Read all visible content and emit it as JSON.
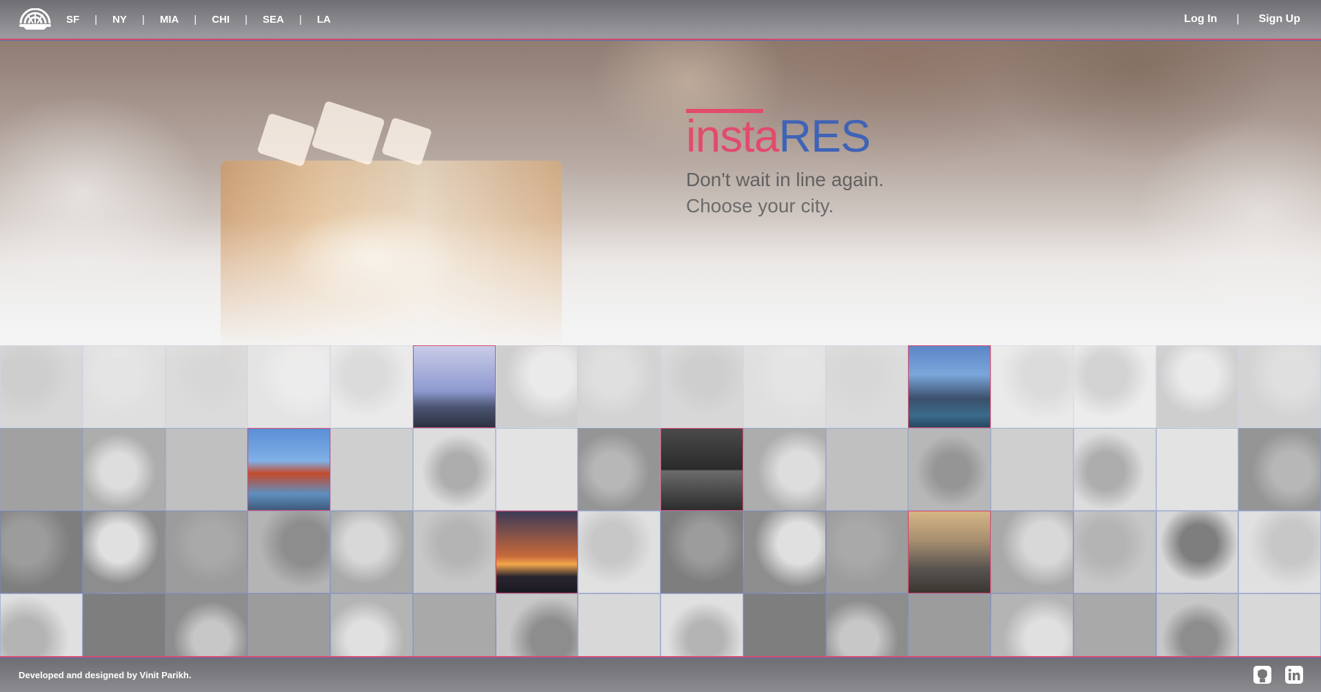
{
  "nav": {
    "cities": [
      "SF",
      "NY",
      "MIA",
      "CHI",
      "SEA",
      "LA"
    ],
    "separator": "|",
    "login": "Log In",
    "signup": "Sign Up"
  },
  "hero": {
    "brand_insta": "insta",
    "brand_res": "RES",
    "tagline_line1": "Don't wait in line again.",
    "tagline_line2": "Choose your city."
  },
  "footer": {
    "credit": "Developed and designed by Vinit Parikh.",
    "icons": [
      "github-icon",
      "linkedin-icon"
    ]
  },
  "colors": {
    "brand_pink": "#e24b6b",
    "brand_blue": "#3f63b6",
    "nav_bg": "#7d7d82"
  }
}
